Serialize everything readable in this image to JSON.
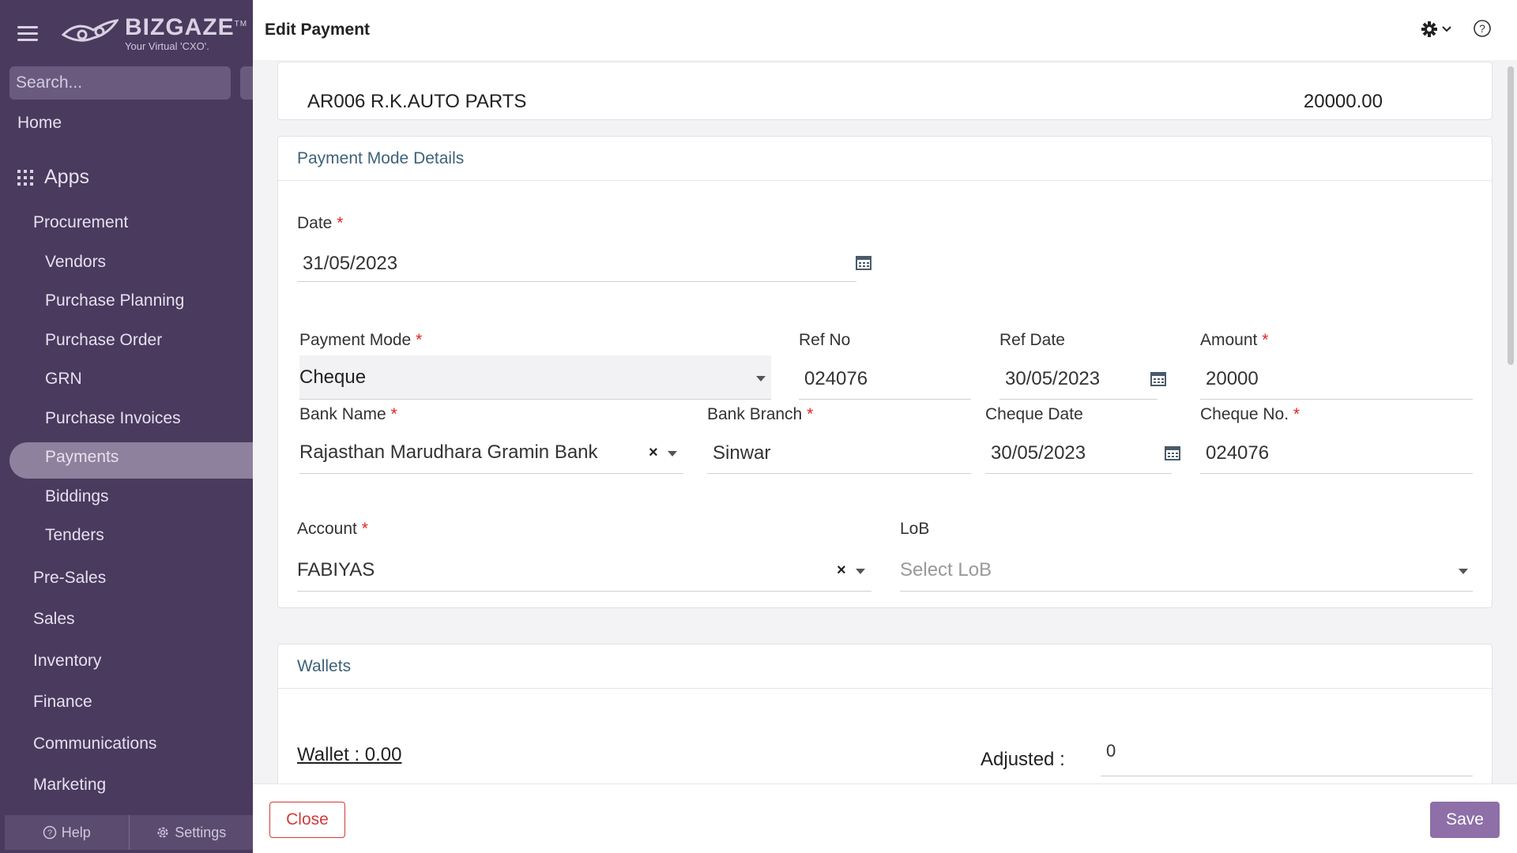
{
  "brand": {
    "name": "BIZGAZE",
    "trademark": "TM",
    "tagline": "Your Virtual 'CXO'."
  },
  "search": {
    "placeholder": "Search..."
  },
  "nav": {
    "home": "Home",
    "apps": "Apps",
    "procurement": "Procurement",
    "procurement_items": [
      "Vendors",
      "Purchase Planning",
      "Purchase Order",
      "GRN",
      "Purchase Invoices",
      "Payments",
      "Biddings",
      "Tenders"
    ],
    "sections": [
      "Pre-Sales",
      "Sales",
      "Inventory",
      "Finance",
      "Communications",
      "Marketing"
    ],
    "active": "Payments"
  },
  "footer": {
    "help": "Help",
    "settings": "Settings"
  },
  "page": {
    "title": "Edit Payment"
  },
  "summary": {
    "vendor": "AR006 R.K.AUTO PARTS",
    "amount": "20000.00"
  },
  "payment_mode_section": {
    "title": "Payment Mode Details",
    "date": {
      "label": "Date",
      "value": "31/05/2023"
    },
    "payment_mode": {
      "label": "Payment Mode",
      "value": "Cheque"
    },
    "ref_no": {
      "label": "Ref No",
      "value": "024076"
    },
    "ref_date": {
      "label": "Ref Date",
      "value": "30/05/2023"
    },
    "amount": {
      "label": "Amount",
      "value": "20000"
    },
    "bank_name": {
      "label": "Bank Name",
      "value": "Rajasthan Marudhara Gramin Bank"
    },
    "bank_branch": {
      "label": "Bank Branch",
      "value": "Sinwar"
    },
    "cheque_date": {
      "label": "Cheque Date",
      "value": "30/05/2023"
    },
    "cheque_no": {
      "label": "Cheque No.",
      "value": "024076"
    },
    "account": {
      "label": "Account",
      "value": "FABIYAS"
    },
    "lob": {
      "label": "LoB",
      "placeholder": "Select LoB"
    },
    "required_mark": "*"
  },
  "wallets_section": {
    "title": "Wallets",
    "wallet_label": "Wallet : 0.00",
    "adjusted_label": "Adjusted :",
    "adjusted_value": "0"
  },
  "actions": {
    "close": "Close",
    "save": "Save"
  },
  "colors": {
    "sidebar": "#4a3a5e",
    "accent": "#8e6fa8",
    "danger": "#d43a3a",
    "required": "#e02424"
  },
  "icons": [
    "hamburger-icon",
    "search-icon",
    "apps-grid-icon",
    "help-icon",
    "gear-icon",
    "calendar-icon",
    "clear-icon",
    "chevron-down-icon"
  ]
}
